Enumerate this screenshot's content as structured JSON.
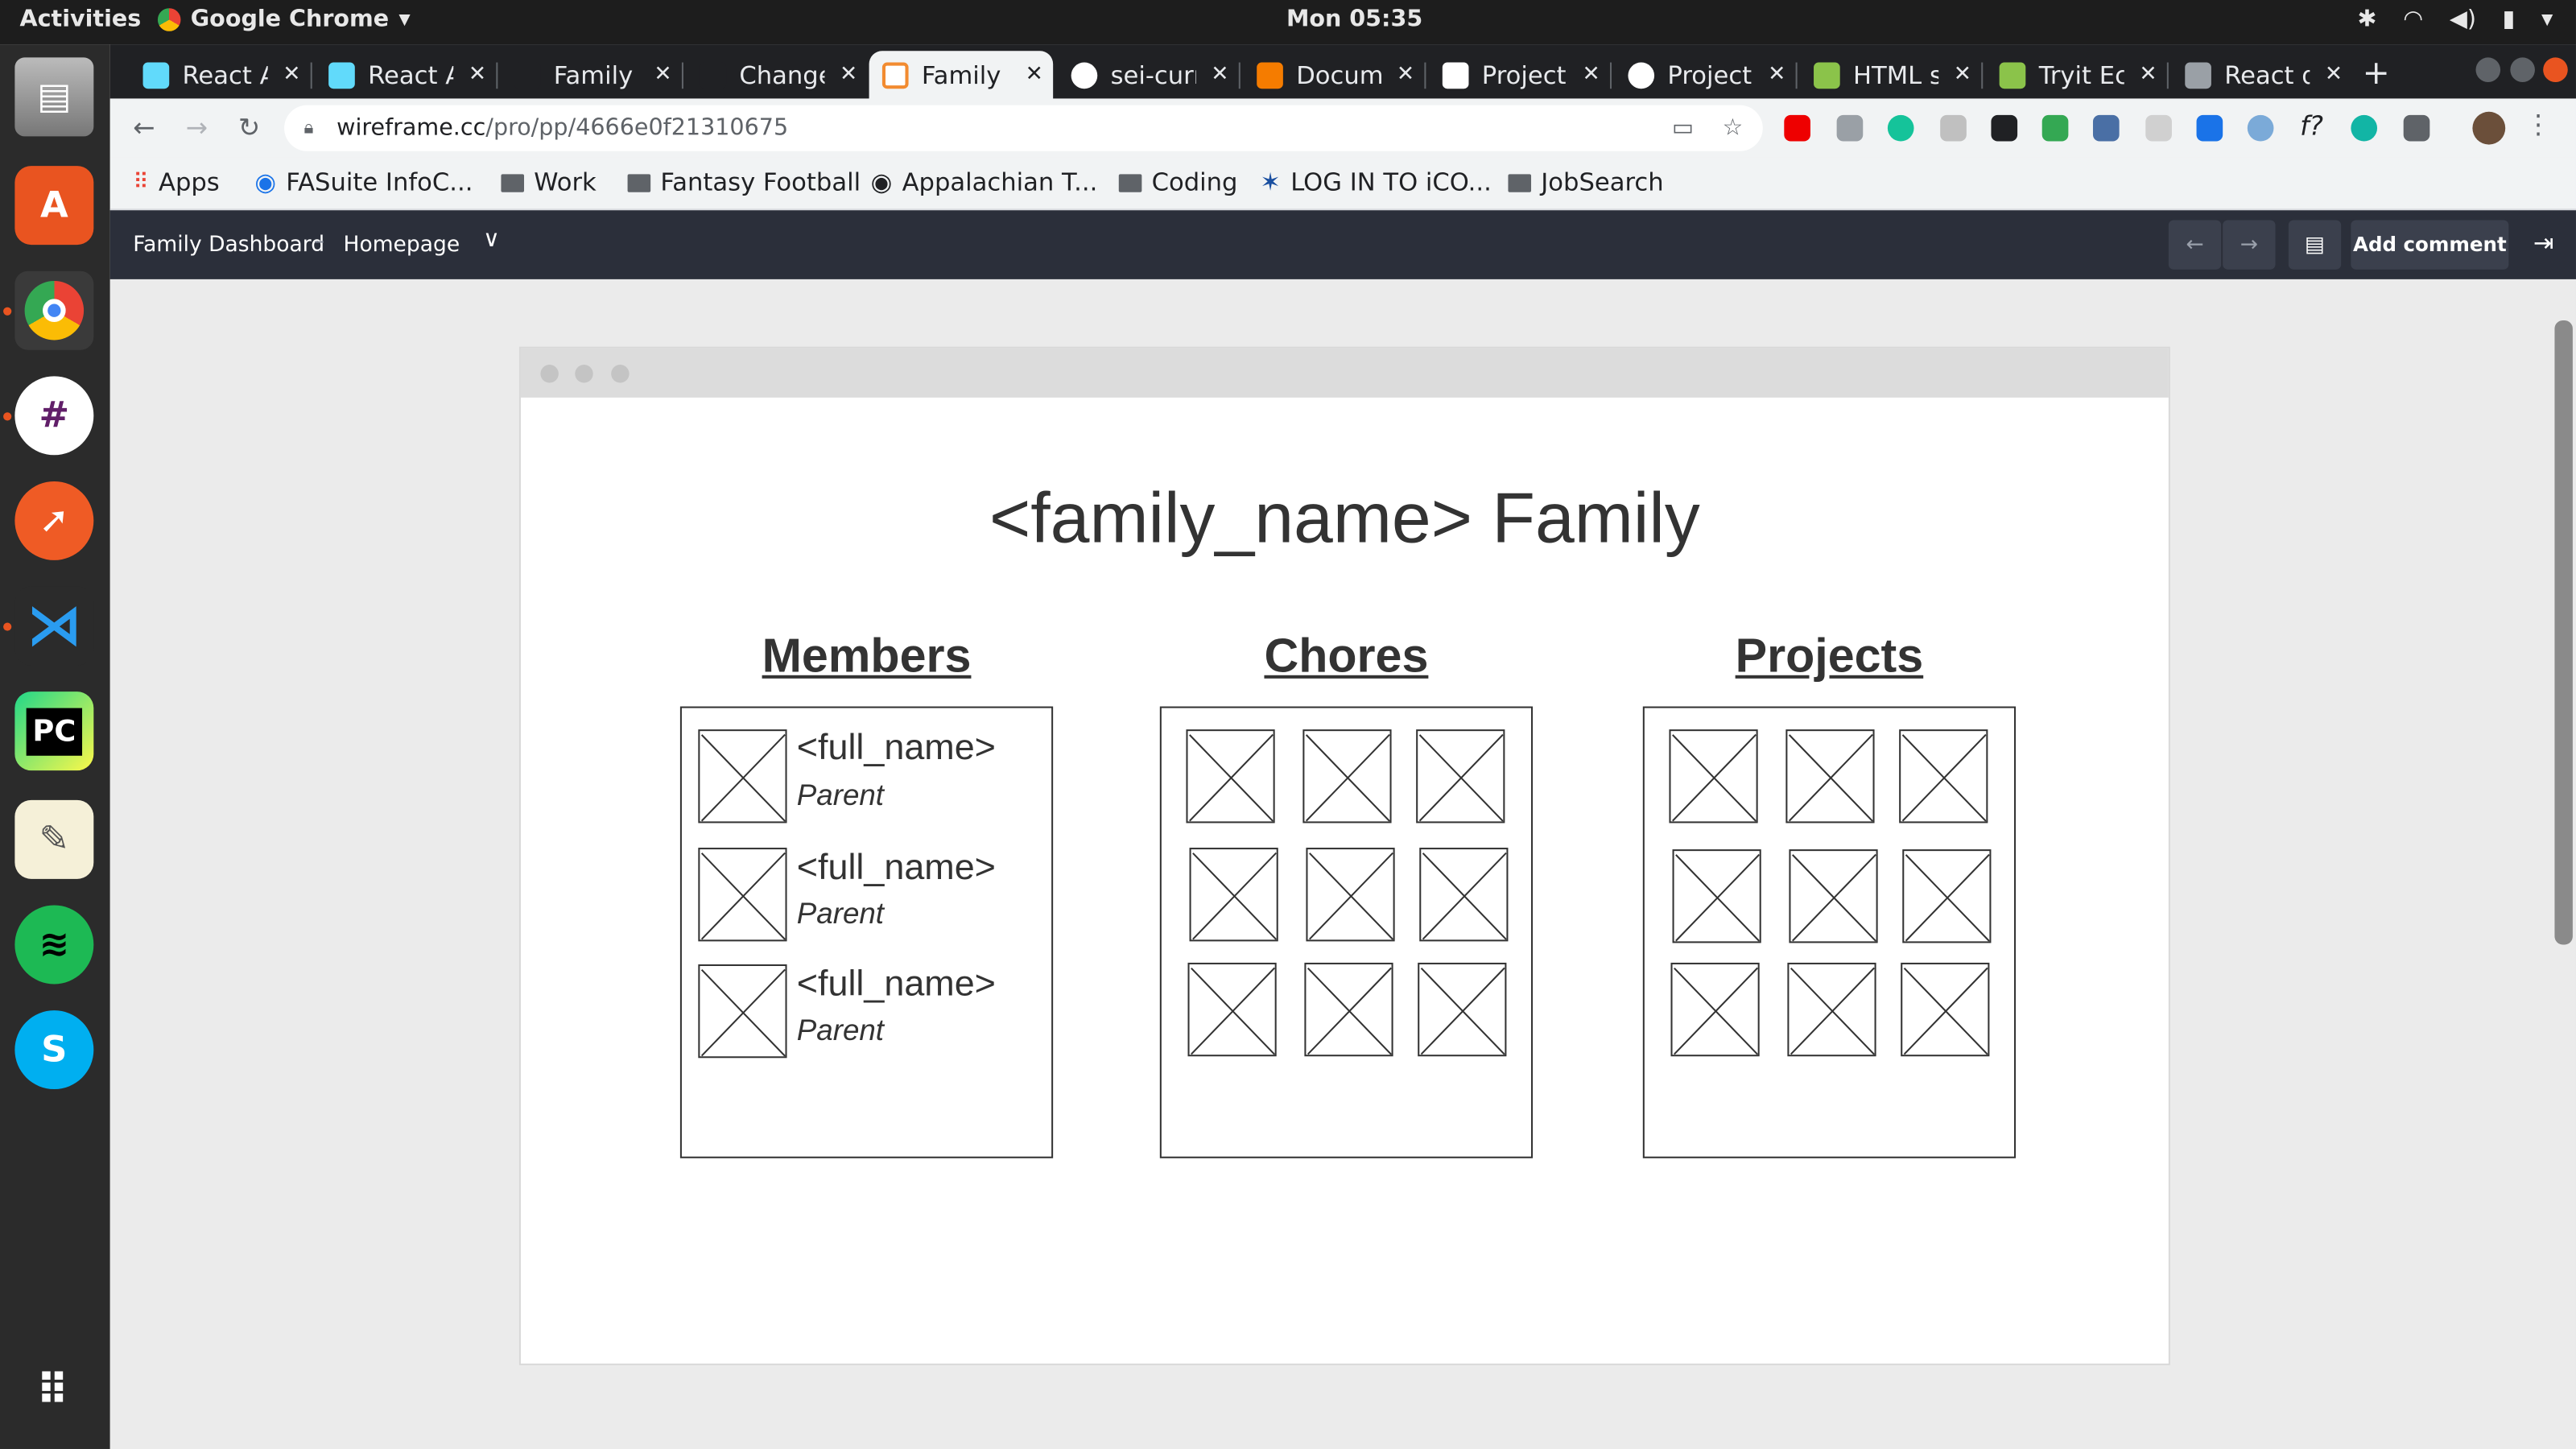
{
  "system": {
    "activities": "Activities",
    "app_name": "Google Chrome",
    "clock": "Mon 05:35"
  },
  "tabs": [
    {
      "label": "React A",
      "color": "#61dafb"
    },
    {
      "label": "React A",
      "color": "#61dafb"
    },
    {
      "label": "Family /",
      "color": "#202124"
    },
    {
      "label": "Change",
      "color": "#202124"
    },
    {
      "label": "Family [",
      "color": "#f28b30"
    },
    {
      "label": "sei-curr",
      "color": "#ffffff"
    },
    {
      "label": "Docume",
      "color": "#f57c00"
    },
    {
      "label": "Project",
      "color": "#ffffff"
    },
    {
      "label": "Project",
      "color": "#ffffff"
    },
    {
      "label": "HTML s",
      "color": "#8bc34a"
    },
    {
      "label": "Tryit Ec",
      "color": "#8bc34a"
    },
    {
      "label": "React d",
      "color": "#9aa0a6"
    }
  ],
  "address_bar": {
    "domain": "wireframe.cc",
    "path": "/pro/pp/4666e0f21310675"
  },
  "bookmarks": [
    "Apps",
    "FASuite InfoC...",
    "Work",
    "Fantasy Football",
    "Appalachian T...",
    "Coding",
    "LOG IN TO iCO...",
    "JobSearch"
  ],
  "wireframe_app": {
    "project": "Family Dashboard",
    "page": "Homepage",
    "add_comment": "Add comment"
  },
  "mockup": {
    "title": "<family_name> Family",
    "members_heading": "Members",
    "chores_heading": "Chores",
    "projects_heading": "Projects",
    "members": [
      {
        "name": "<full_name>",
        "role": "Parent"
      },
      {
        "name": "<full_name>",
        "role": "Parent"
      },
      {
        "name": "<full_name>",
        "role": "Parent"
      }
    ]
  }
}
